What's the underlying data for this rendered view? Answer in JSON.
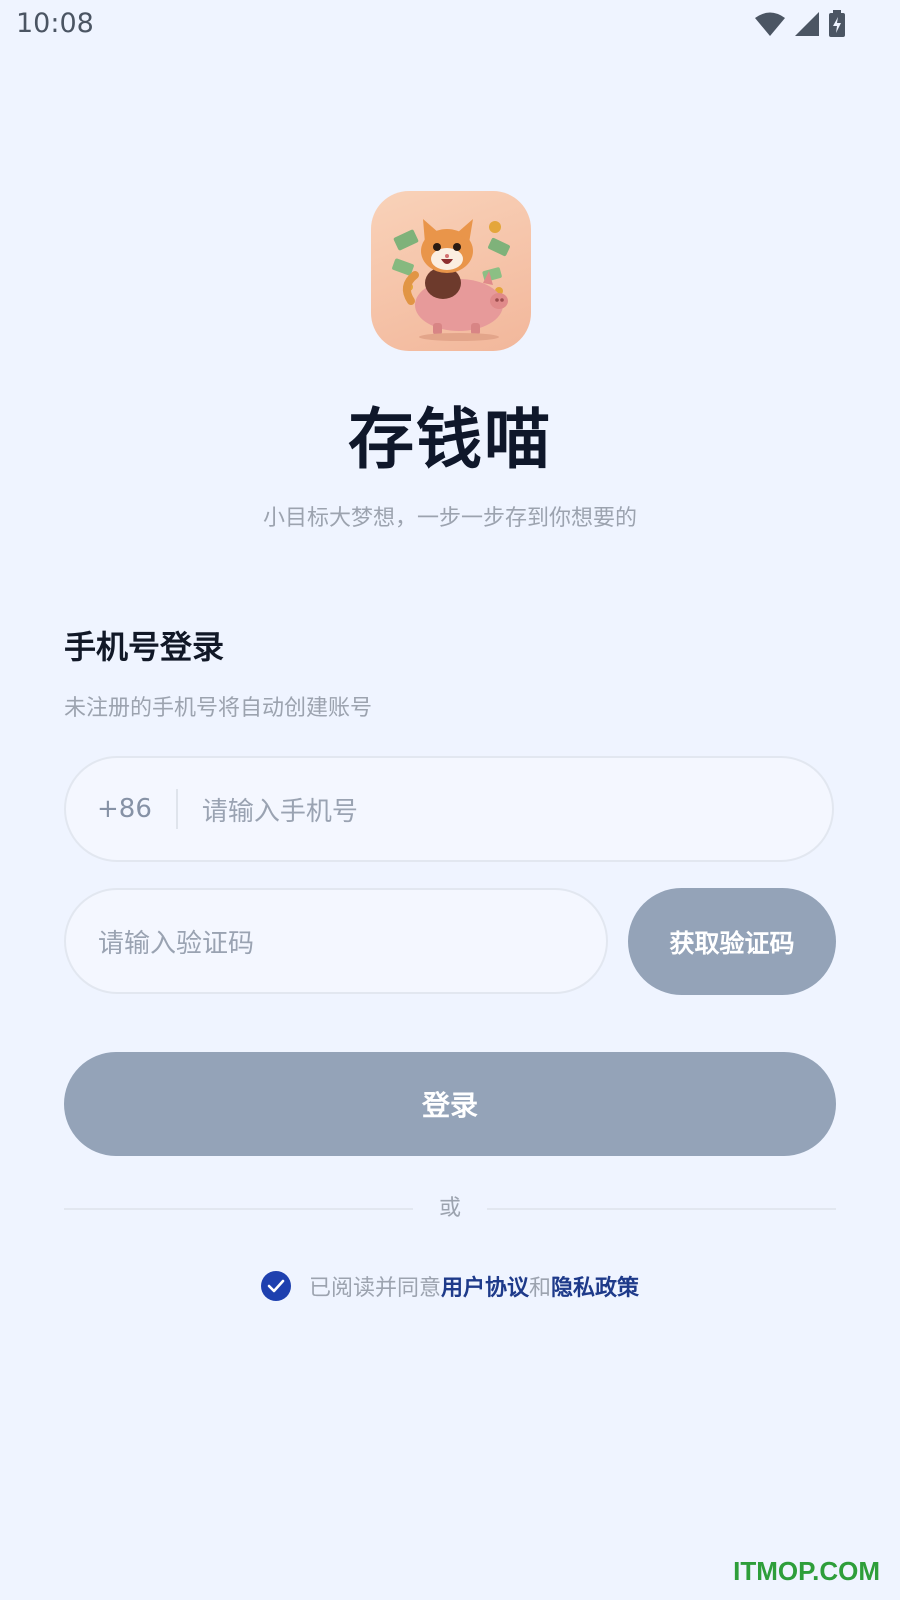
{
  "status_bar": {
    "time": "10:08",
    "icons": [
      "wifi-icon",
      "signal-icon",
      "battery-charging-icon"
    ]
  },
  "app": {
    "icon": "cat-piggy-bank-logo",
    "title": "存钱喵",
    "slogan": "小目标大梦想，一步一步存到你想要的"
  },
  "login": {
    "heading": "手机号登录",
    "hint": "未注册的手机号将自动创建账号",
    "country_code": "+86",
    "phone_placeholder": "请输入手机号",
    "code_placeholder": "请输入验证码",
    "get_code_label": "获取验证码",
    "submit_label": "登录",
    "or_label": "或"
  },
  "agreement": {
    "checked": true,
    "prefix": "已阅读并同意",
    "user_agreement": "用户协议",
    "and": "和",
    "privacy_policy": "隐私政策"
  },
  "colors": {
    "background": "#eff4ff",
    "accent": "#1e40af",
    "disabled_button": "#94a3b8"
  },
  "watermark": "ITMOP.COM"
}
